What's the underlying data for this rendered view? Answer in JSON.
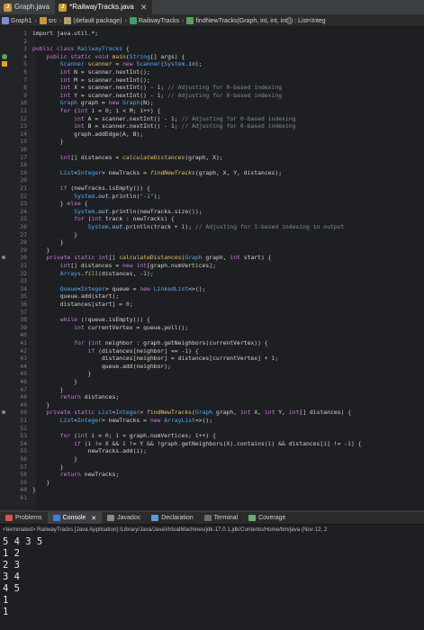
{
  "tabs": [
    {
      "label": "Graph.java",
      "active": false
    },
    {
      "label": "*RailwayTracks.java",
      "active": true
    }
  ],
  "breadcrumbs": [
    "Graph1",
    "src",
    "(default package)",
    "RailwayTracks",
    "findNewTracks(Graph, int, int, int[]) : List<Integ"
  ],
  "editor": {
    "lines": [
      {
        "n": "1",
        "h": "import java.util.*;"
      },
      {
        "n": "2",
        "h": ""
      },
      {
        "n": "3",
        "h": "<span class='kw'>public class</span> <span class='ty'>RailwayTracks</span> {"
      },
      {
        "n": "4",
        "marker": "green",
        "h": "    <span class='kw'>public static void</span> <span class='fn'>main</span>(<span class='ty'>String</span>[] args) {"
      },
      {
        "n": "5",
        "marker": "warn",
        "h": "        <span class='ty'>Scanner</span> <span class='fn'>scanner</span> = <span class='kw'>new</span> <span class='ty'>Scanner</span>(<span class='ty'>System</span>.<span class='fld it'>in</span>);"
      },
      {
        "n": "6",
        "h": "        <span class='kw'>int</span> N = scanner.nextInt();"
      },
      {
        "n": "7",
        "h": "        <span class='kw'>int</span> M = scanner.nextInt();"
      },
      {
        "n": "8",
        "h": "        <span class='kw'>int</span> X = scanner.nextInt() - <span class='num'>1</span>; <span class='cm'>// Adjusting for 0-based indexing</span>"
      },
      {
        "n": "9",
        "h": "        <span class='kw'>int</span> Y = scanner.nextInt() - <span class='num'>1</span>; <span class='cm'>// Adjusting for 0-based indexing</span>"
      },
      {
        "n": "10",
        "h": "        <span class='ty'>Graph</span> graph = <span class='kw'>new</span> <span class='ty'>Graph</span>(N);"
      },
      {
        "n": "11",
        "h": "        <span class='kw'>for</span> (<span class='kw'>int</span> i = <span class='num'>0</span>; i &lt; M; i++) {"
      },
      {
        "n": "12",
        "h": "            <span class='kw'>int</span> A = scanner.nextInt() - <span class='num'>1</span>; <span class='cm'>// Adjusting for 0-based indexing</span>"
      },
      {
        "n": "13",
        "h": "            <span class='kw'>int</span> B = scanner.nextInt() - <span class='num'>1</span>; <span class='cm'>// Adjusting for 0-based indexing</span>"
      },
      {
        "n": "14",
        "h": "            graph.addEdge(A, B);"
      },
      {
        "n": "15",
        "h": "        }"
      },
      {
        "n": "16",
        "h": ""
      },
      {
        "n": "17",
        "h": "        <span class='kw'>int</span>[] distances = <span class='fn it'>calculateDistances</span>(graph, X);"
      },
      {
        "n": "18",
        "h": ""
      },
      {
        "n": "19",
        "h": "        <span class='ty'>List</span>&lt;<span class='ty'>Integer</span>&gt; newTracks = <span class='fn it'>findNewTracks</span>(graph, X, Y, distances);"
      },
      {
        "n": "20",
        "h": ""
      },
      {
        "n": "21",
        "h": "        <span class='kw'>if</span> (newTracks.isEmpty()) {"
      },
      {
        "n": "22",
        "h": "            <span class='ty'>System</span>.<span class='fld it'>out</span>.println(<span class='st'>\"-1\"</span>);"
      },
      {
        "n": "23",
        "h": "        } <span class='kw'>else</span> {"
      },
      {
        "n": "24",
        "h": "            <span class='ty'>System</span>.<span class='fld it'>out</span>.println(newTracks.size());"
      },
      {
        "n": "25",
        "h": "            <span class='kw'>for</span> (<span class='kw'>int</span> track : newTracks) {"
      },
      {
        "n": "26",
        "h": "                <span class='ty'>System</span>.<span class='fld it'>out</span>.println(track + <span class='num'>1</span>); <span class='cm'>// Adjusting for 1-based indexing in output</span>"
      },
      {
        "n": "27",
        "h": "            }"
      },
      {
        "n": "28",
        "h": "        }"
      },
      {
        "n": "29",
        "h": "    }"
      },
      {
        "n": "30",
        "marker": "dot",
        "h": "    <span class='kw'>private static int</span>[] <span class='fn'>calculateDistances</span>(<span class='ty'>Graph</span> graph, <span class='kw'>int</span> start) {"
      },
      {
        "n": "31",
        "h": "        <span class='kw'>int</span>[] distances = <span class='kw'>new int</span>[graph.numVertices];"
      },
      {
        "n": "32",
        "h": "        <span class='ty'>Arrays</span>.<span class='fn it'>fill</span>(distances, -<span class='num'>1</span>);"
      },
      {
        "n": "33",
        "h": ""
      },
      {
        "n": "34",
        "h": "        <span class='ty'>Queue</span>&lt;<span class='ty'>Integer</span>&gt; queue = <span class='kw'>new</span> <span class='ty'>LinkedList</span>&lt;&gt;();"
      },
      {
        "n": "35",
        "h": "        queue.add(start);"
      },
      {
        "n": "36",
        "h": "        distances[start] = <span class='num'>0</span>;"
      },
      {
        "n": "37",
        "h": ""
      },
      {
        "n": "38",
        "h": "        <span class='kw'>while</span> (!queue.isEmpty()) {"
      },
      {
        "n": "39",
        "h": "            <span class='kw'>int</span> currentVertex = queue.poll();"
      },
      {
        "n": "40",
        "h": ""
      },
      {
        "n": "41",
        "h": "            <span class='kw'>for</span> (<span class='kw'>int</span> neighbor : graph.getNeighbors(currentVertex)) {"
      },
      {
        "n": "42",
        "h": "                <span class='kw'>if</span> (distances[neighbor] == -<span class='num'>1</span>) {"
      },
      {
        "n": "43",
        "h": "                    distances[neighbor] = distances[currentVertex] + <span class='num'>1</span>;"
      },
      {
        "n": "44",
        "h": "                    queue.add(neighbor);"
      },
      {
        "n": "45",
        "h": "                }"
      },
      {
        "n": "46",
        "h": "            }"
      },
      {
        "n": "47",
        "h": "        }"
      },
      {
        "n": "48",
        "h": "        <span class='kw'>return</span> distances;"
      },
      {
        "n": "49",
        "h": "    }"
      },
      {
        "n": "50",
        "marker": "dot",
        "h": "    <span class='kw'>private static</span> <span class='ty'>List</span>&lt;<span class='ty'>Integer</span>&gt; <span class='fn'>findNewTracks</span>(<span class='ty'>Graph</span> graph, <span class='kw'>int</span> X, <span class='kw'>int</span> Y, <span class='kw'>int</span>[] distances) {"
      },
      {
        "n": "51",
        "h": "        <span class='ty'>List</span>&lt;<span class='ty'>Integer</span>&gt; newTracks = <span class='kw'>new</span> <span class='ty'>ArrayList</span>&lt;&gt;();"
      },
      {
        "n": "52",
        "h": ""
      },
      {
        "n": "53",
        "h": "        <span class='kw'>for</span> (<span class='kw'>int</span> i = <span class='num'>0</span>; i &lt; graph.numVertices; i++) {"
      },
      {
        "n": "54",
        "h": "            <span class='kw'>if</span> (i != X &amp;&amp; i != Y &amp;&amp; !graph.getNeighbors(X).contains(i) &amp;&amp; distances[i] != -<span class='num'>1</span>) {"
      },
      {
        "n": "55",
        "h": "                newTracks.add(i);"
      },
      {
        "n": "56",
        "h": "            }"
      },
      {
        "n": "57",
        "h": "        }"
      },
      {
        "n": "58",
        "h": "        <span class='kw'>return</span> newTracks;"
      },
      {
        "n": "59",
        "h": "    }"
      },
      {
        "n": "60",
        "h": "}"
      },
      {
        "n": "61",
        "h": ""
      }
    ]
  },
  "panel": {
    "tabs": [
      {
        "label": "Problems",
        "color": "#d9534f",
        "active": false
      },
      {
        "label": "Console",
        "color": "#3d7fd9",
        "active": true,
        "closable": true
      },
      {
        "label": "Javadoc",
        "color": "#8a8a8a",
        "active": false
      },
      {
        "label": "Declaration",
        "color": "#5a9bd5",
        "active": false
      },
      {
        "label": "Terminal",
        "color": "#6c6c6c",
        "active": false
      },
      {
        "label": "Coverage",
        "color": "#6aab73",
        "active": false
      }
    ],
    "terminated_text": "<terminated> RailwayTracks [Java Application] /Library/Java/JavaVirtualMachines/jdk-17.0.1.jdk/Contents/Home/bin/java  (Nov 12, 2",
    "console_lines": [
      "5 4 3 5",
      "1 2",
      "2 3",
      "3 4",
      "4 5",
      "1",
      "1"
    ]
  },
  "colors": {
    "editor_bg": "#1e1f22",
    "keyword": "#cc7cdc",
    "type": "#56a8f5",
    "comment": "#7f8c8d"
  }
}
